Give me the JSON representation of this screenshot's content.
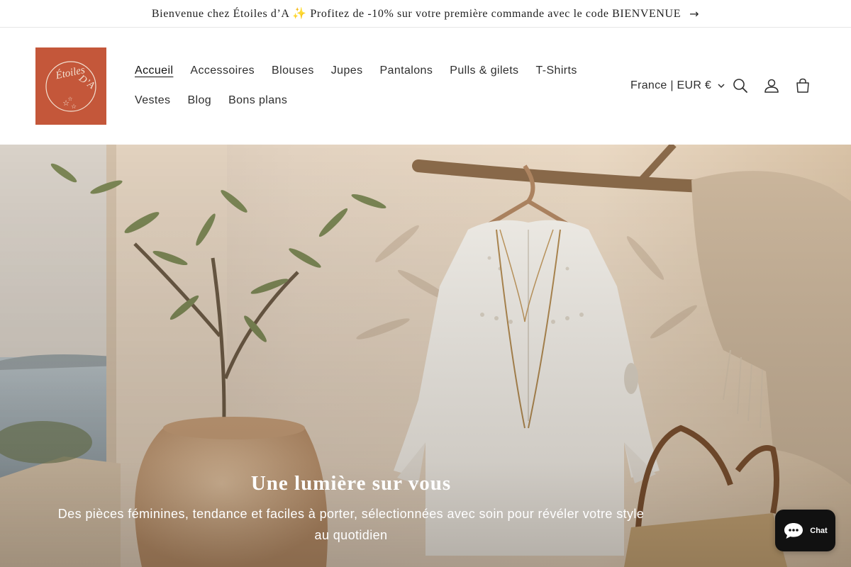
{
  "announcement": {
    "text": "Bienvenue chez Étoiles d’A ✨ Profitez de -10% sur votre première commande avec le code BIENVENUE",
    "arrow_icon": "arrow-right-icon"
  },
  "brand": {
    "logo_text": "ÉTOILES D’A",
    "logo_color": "#c4573a"
  },
  "nav": {
    "row1": [
      "Accueil",
      "Accessoires",
      "Blouses",
      "Jupes",
      "Pantalons",
      "Pulls & gilets",
      "T-Shirts"
    ],
    "row2": [
      "Vestes",
      "Blog",
      "Bons plans"
    ],
    "active": "Accueil"
  },
  "header": {
    "locale": "France | EUR €",
    "icons": [
      "chevron-down-icon",
      "search-icon",
      "account-icon",
      "cart-icon"
    ]
  },
  "hero": {
    "title": "Une lumière sur vous",
    "text": "Des pièces féminines, tendance et faciles à porter, sélectionnées avec soin pour révéler votre style au quotidien"
  },
  "chat": {
    "label": "Chat",
    "icon": "chat-bubble-icon",
    "color": "#111111"
  }
}
